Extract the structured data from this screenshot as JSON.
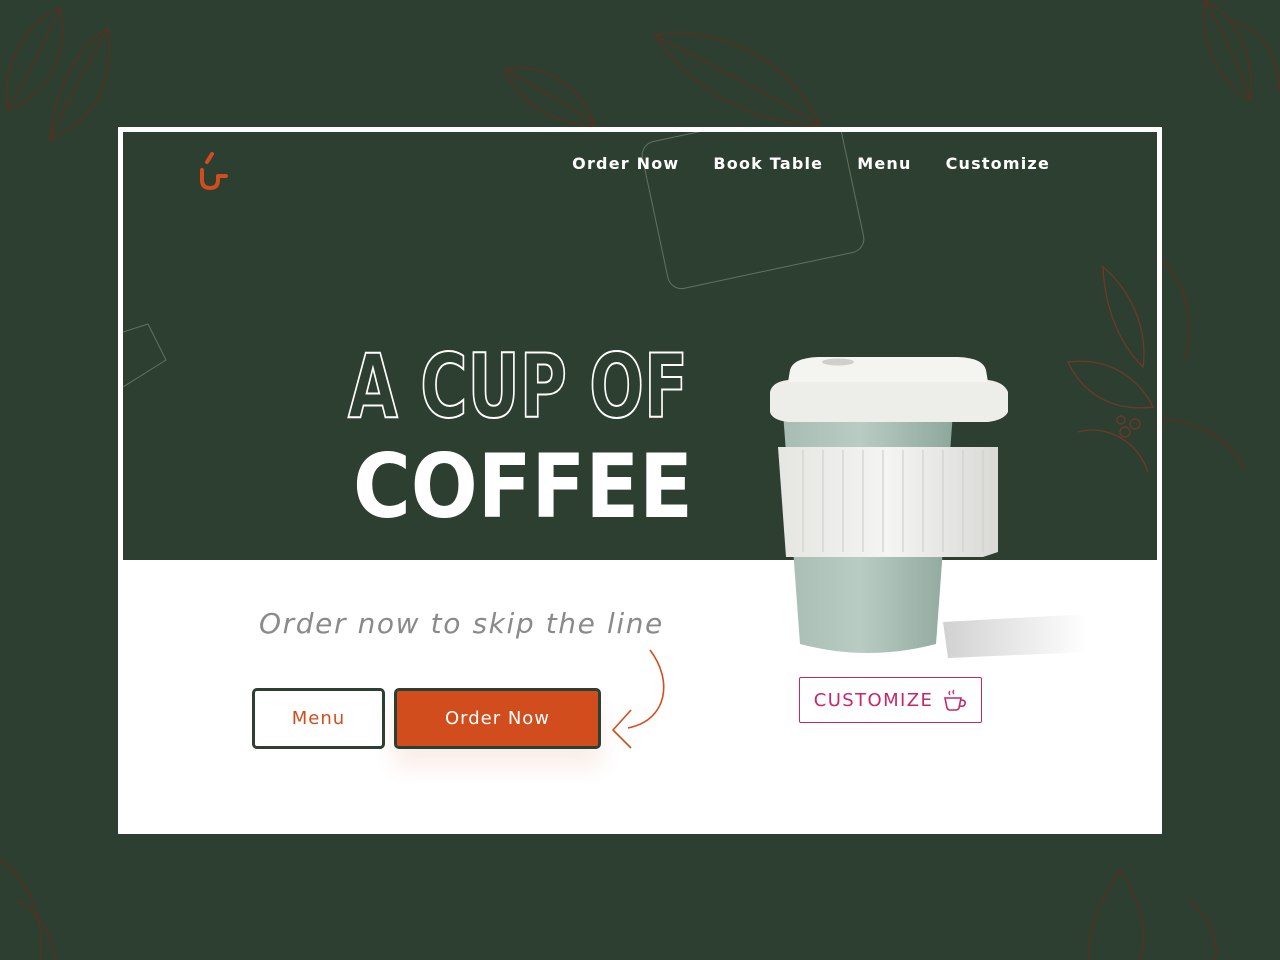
{
  "brand": {
    "accent_color": "#d24d1d",
    "background_color": "#2c3f30",
    "customize_color": "#c6276b"
  },
  "nav": {
    "items": [
      "Order Now",
      "Book Table",
      "Menu",
      "Customize"
    ]
  },
  "hero": {
    "headline_line1": "A CUP OF",
    "headline_line2": "COFFEE",
    "subline": "Order now to skip the line"
  },
  "buttons": {
    "menu_label": "Menu",
    "order_label": "Order Now",
    "customize_label": "CUSTOMIZE"
  },
  "icons": {
    "logo": "cup-logo-icon",
    "customize": "coffee-cup-icon",
    "arrow": "curved-arrow-icon"
  }
}
